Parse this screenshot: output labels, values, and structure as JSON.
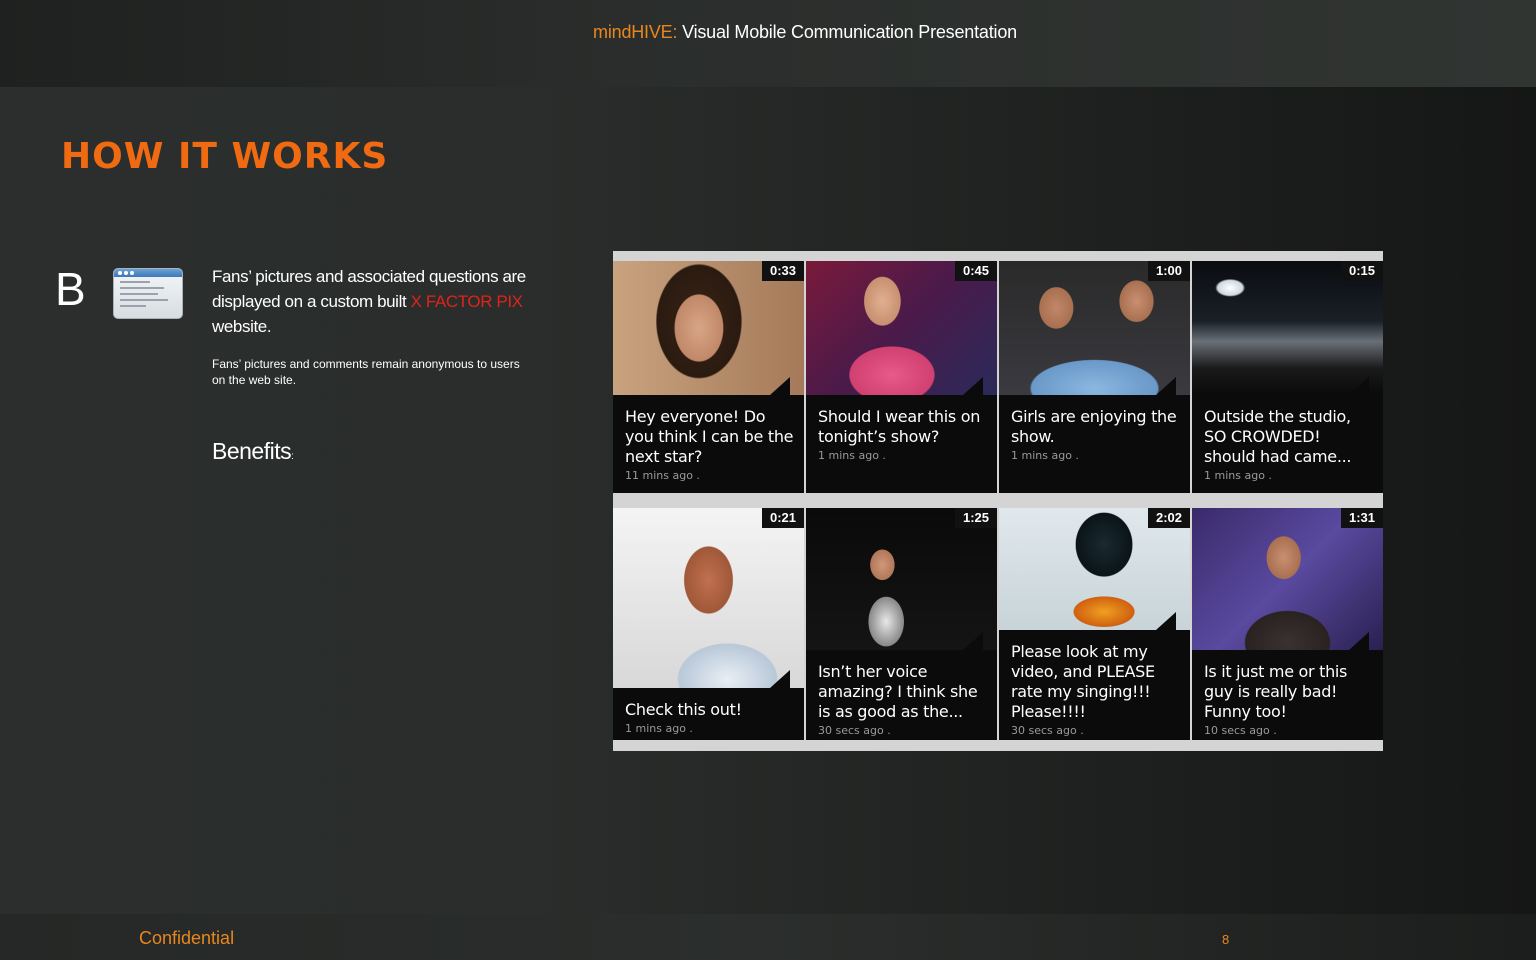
{
  "header": {
    "brand": "mindHIVE:",
    "title": "Visual Mobile Communication Presentation"
  },
  "section_title": "HOW IT WORKS",
  "step": {
    "letter": "B",
    "icon": "browser-window-icon",
    "desc_before": "Fans’ pictures and associated questions are displayed on a custom built ",
    "desc_highlight": "X FACTOR PIX",
    "desc_after": " website.",
    "sub_text": "Fans’ pictures and comments remain anonymous to users on the web site.",
    "benefits_label": "Benefits",
    "benefits_colon": ":"
  },
  "tiles": [
    {
      "timer": "0:33",
      "text": "Hey everyone! Do you think I can be the next star?",
      "time": "11 mins ago ."
    },
    {
      "timer": "0:45",
      "text": "Should I wear this on tonight’s show?",
      "time": "1 mins ago ."
    },
    {
      "timer": "1:00",
      "text": "Girls are enjoying the show.",
      "time": "1 mins ago ."
    },
    {
      "timer": "0:15",
      "text": "Outside the studio, SO CROWDED! should had came...",
      "time": "1 mins ago ."
    },
    {
      "timer": "0:21",
      "text": "Check this out!",
      "time": "1 mins ago ."
    },
    {
      "timer": "1:25",
      "text": "Isn’t her voice amazing? I think she is as good as the...",
      "time": "30 secs ago ."
    },
    {
      "timer": "2:02",
      "text": "Please look at my video, and PLEASE rate my singing!!! Please!!!!",
      "time": "30 secs ago ."
    },
    {
      "timer": "1:31",
      "text": "Is it just me or this guy is really bad! Funny too!",
      "time": "10 secs ago ."
    }
  ],
  "footer": {
    "confidential": "Confidential",
    "page": "8"
  },
  "colors": {
    "accent_orange": "#f06a12",
    "highlight_red": "#e0231a",
    "header_brand": "#e8871e"
  }
}
